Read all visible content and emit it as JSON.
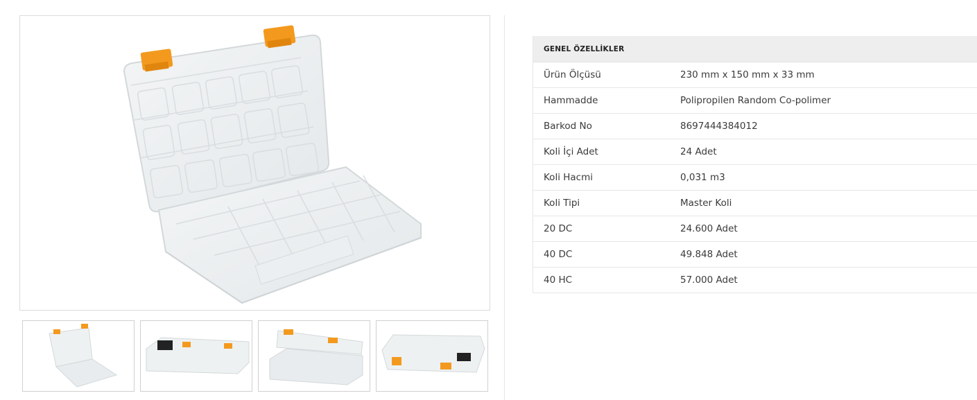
{
  "product": {
    "main_image_alt": "",
    "thumbnails": [
      {
        "name": "thumbnail-open-front"
      },
      {
        "name": "thumbnail-closed-top"
      },
      {
        "name": "thumbnail-open-angle"
      },
      {
        "name": "thumbnail-closed-side"
      }
    ],
    "colors": {
      "clip": "#f39a1e",
      "plastic": "#e9ecee",
      "border": "#dcdcdc"
    }
  },
  "specs": {
    "header": "GENEL ÖZELLİKLER",
    "rows": [
      {
        "key": "Ürün Ölçüsü",
        "value": "230 mm x 150 mm x 33 mm"
      },
      {
        "key": "Hammadde",
        "value": "Polipropilen Random Co-polimer"
      },
      {
        "key": "Barkod No",
        "value": "8697444384012"
      },
      {
        "key": "Koli İçi Adet",
        "value": "24 Adet"
      },
      {
        "key": "Koli Hacmi",
        "value": "0,031 m3"
      },
      {
        "key": "Koli Tipi",
        "value": "Master Koli"
      },
      {
        "key": "20 DC",
        "value": "24.600 Adet"
      },
      {
        "key": "40 DC",
        "value": "49.848 Adet"
      },
      {
        "key": "40 HC",
        "value": "57.000 Adet"
      }
    ]
  }
}
